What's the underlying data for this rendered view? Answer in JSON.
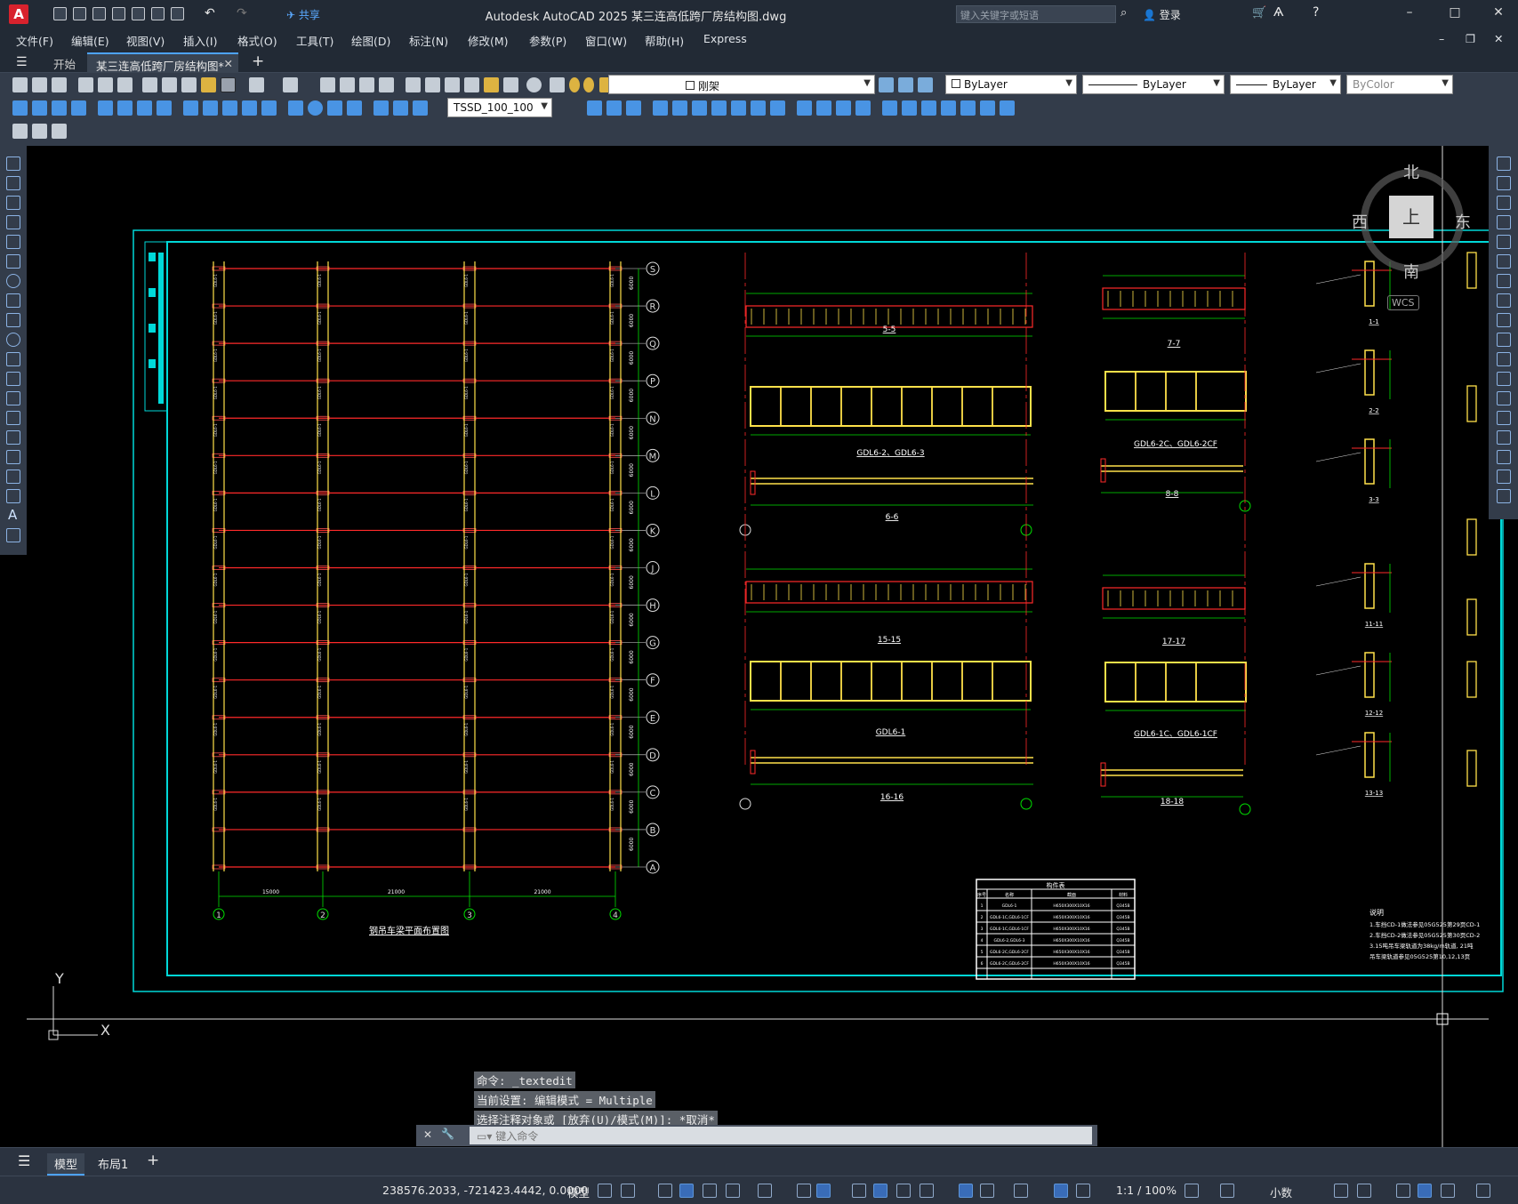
{
  "app": {
    "title": "Autodesk AutoCAD 2025    某三连高低跨厂房结构图.dwg",
    "logo": "A",
    "share_label": "共享",
    "search_placeholder": "键入关键字或短语",
    "login_label": "登录"
  },
  "menu": [
    "文件(F)",
    "编辑(E)",
    "视图(V)",
    "插入(I)",
    "格式(O)",
    "工具(T)",
    "绘图(D)",
    "标注(N)",
    "修改(M)",
    "参数(P)",
    "窗口(W)",
    "帮助(H)",
    "Express"
  ],
  "tabs": {
    "start": "开始",
    "active_file": "某三连高低跨厂房结构图*"
  },
  "toolbar": {
    "layer_name": "刚架",
    "color": "ByLayer",
    "linetype": "ByLayer",
    "lineweight": "ByLayer",
    "plotstyle": "ByColor",
    "dimstyle": "TSSD_100_100"
  },
  "viewcube": {
    "north": "北",
    "south": "南",
    "east": "东",
    "west": "西",
    "face": "上",
    "wcs": "WCS"
  },
  "drawing": {
    "plan_title": "钢吊车梁平面布置图",
    "grid_rows": [
      "S",
      "R",
      "Q",
      "P",
      "N",
      "M",
      "L",
      "K",
      "J",
      "H",
      "G",
      "F",
      "E",
      "D",
      "C",
      "B",
      "A"
    ],
    "grid_cols": [
      "1",
      "2",
      "3",
      "4"
    ],
    "bay_dims": [
      "15000",
      "21000",
      "21000"
    ],
    "sections": {
      "s55": "5-5",
      "gdl62": "GDL6-2、GDL6-3",
      "s66": "6-6",
      "s77": "7-7",
      "gdl62c": "GDL6-2C、GDL6-2CF",
      "s88": "8-8",
      "s1515": "15-15",
      "gdl61": "GDL6-1",
      "s1616": "16-16",
      "s1717": "17-17",
      "gdl61c": "GDL6-1C、GDL6-1CF",
      "s1818": "18-18"
    },
    "details": [
      "1-1",
      "2-2",
      "3-3",
      "11-11",
      "12-12",
      "13-13"
    ],
    "table_title": "构件表",
    "table_headers": [
      "序号",
      "名称",
      "截面",
      "材料"
    ],
    "table_rows": [
      [
        "1",
        "GDL6-1",
        "H650X300X10X16",
        "Q345B"
      ],
      [
        "2",
        "GDL6-1C,GDL6-1CF",
        "H650X300X10X16",
        "Q345B"
      ],
      [
        "3",
        "GDL6-1C,GDL6-1CF",
        "H650X300X10X16",
        "Q345B"
      ],
      [
        "4",
        "GDL6-2,GDL6-3",
        "H650X300X10X16",
        "Q345B"
      ],
      [
        "5",
        "GDL6-2C,GDL6-2CF",
        "H650X300X10X16",
        "Q345B"
      ],
      [
        "6",
        "GDL6-2C,GDL6-2CF",
        "H650X300X10X16",
        "Q345B"
      ]
    ],
    "notes_title": "说明",
    "notes": [
      "1.车挡CD-1做法参见05G525第29页CD-1",
      "2.车挡CD-2做法参见05G525第30页CD-2",
      "3.15吨吊车梁轨道为38kg/m轨道, 21吨",
      "吊车梁轨道参见05G525第10,12,13页"
    ]
  },
  "command": {
    "history": [
      "命令: _textedit",
      "当前设置: 编辑模式 = Multiple",
      "选择注释对象或 [放弃(U)/模式(M)]: *取消*"
    ],
    "placeholder": "键入命令"
  },
  "layout_tabs": [
    "模型",
    "布局1"
  ],
  "status": {
    "coords": "238576.2033, -721423.4442, 0.0000",
    "model": "模型",
    "scale": "1:1 / 100%",
    "units": "小数"
  }
}
